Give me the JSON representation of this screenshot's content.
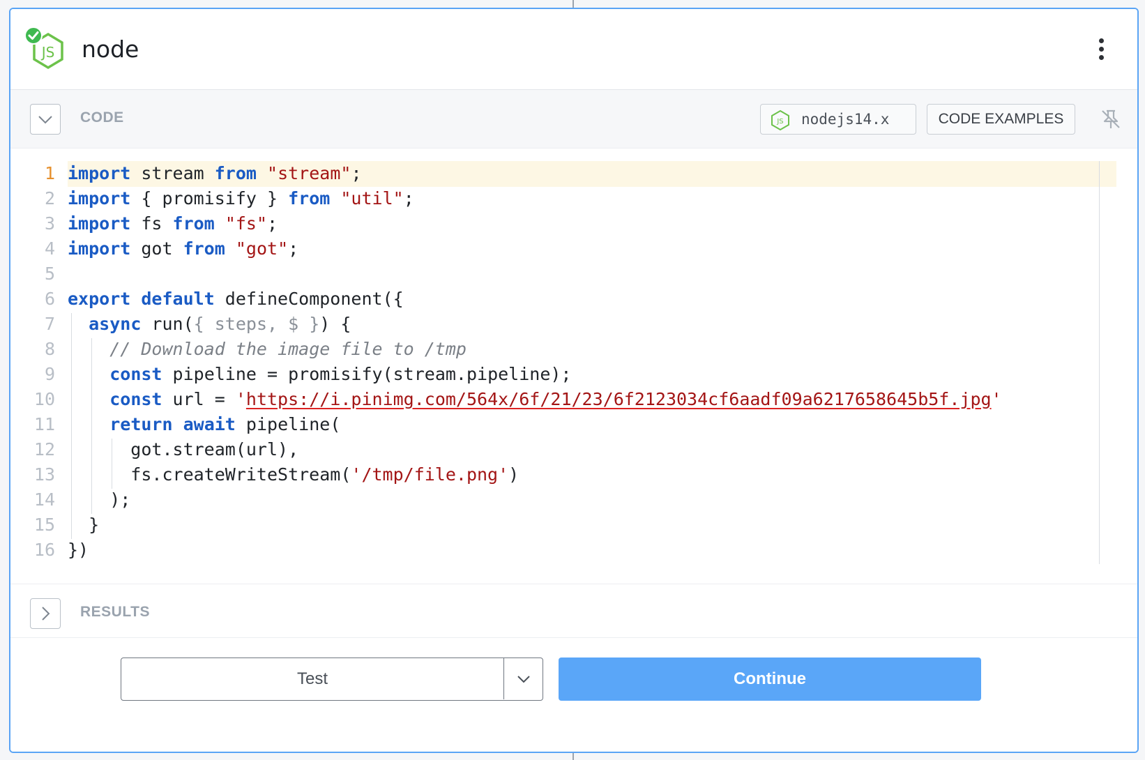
{
  "header": {
    "title": "node",
    "menu_icon": "kebab-menu-icon"
  },
  "code_section": {
    "label": "CODE",
    "runtime": "nodejs14.x",
    "examples_label": "CODE EXAMPLES"
  },
  "editor": {
    "active_line": 1,
    "lines": [
      {
        "n": "1",
        "segs": [
          {
            "t": "import",
            "c": "kw"
          },
          {
            "t": " stream "
          },
          {
            "t": "from",
            "c": "kw"
          },
          {
            "t": " "
          },
          {
            "t": "\"stream\"",
            "c": "str"
          },
          {
            "t": ";"
          }
        ]
      },
      {
        "n": "2",
        "segs": [
          {
            "t": "import",
            "c": "kw"
          },
          {
            "t": " { promisify } "
          },
          {
            "t": "from",
            "c": "kw"
          },
          {
            "t": " "
          },
          {
            "t": "\"util\"",
            "c": "str"
          },
          {
            "t": ";"
          }
        ]
      },
      {
        "n": "3",
        "segs": [
          {
            "t": "import",
            "c": "kw"
          },
          {
            "t": " fs "
          },
          {
            "t": "from",
            "c": "kw"
          },
          {
            "t": " "
          },
          {
            "t": "\"fs\"",
            "c": "str"
          },
          {
            "t": ";"
          }
        ]
      },
      {
        "n": "4",
        "segs": [
          {
            "t": "import",
            "c": "kw"
          },
          {
            "t": " got "
          },
          {
            "t": "from",
            "c": "kw"
          },
          {
            "t": " "
          },
          {
            "t": "\"got\"",
            "c": "str"
          },
          {
            "t": ";"
          }
        ]
      },
      {
        "n": "5",
        "segs": []
      },
      {
        "n": "6",
        "segs": [
          {
            "t": "export",
            "c": "kw"
          },
          {
            "t": " "
          },
          {
            "t": "default",
            "c": "kw"
          },
          {
            "t": " defineComponent({"
          }
        ]
      },
      {
        "n": "7",
        "segs": [
          {
            "t": "  "
          },
          {
            "t": "async",
            "c": "kw"
          },
          {
            "t": " run("
          },
          {
            "t": "{ steps, $ }",
            "c": "dim"
          },
          {
            "t": ") {"
          }
        ]
      },
      {
        "n": "8",
        "segs": [
          {
            "t": "    "
          },
          {
            "t": "// Download the image file to /tmp",
            "c": "cmt"
          }
        ]
      },
      {
        "n": "9",
        "segs": [
          {
            "t": "    "
          },
          {
            "t": "const",
            "c": "kw"
          },
          {
            "t": " pipeline = promisify(stream.pipeline);"
          }
        ]
      },
      {
        "n": "10",
        "segs": [
          {
            "t": "    "
          },
          {
            "t": "const",
            "c": "kw"
          },
          {
            "t": " url = "
          },
          {
            "t": "'",
            "c": "str"
          },
          {
            "t": "https://i.pinimg.com/564x/6f/21/23/6f2123034cf6aadf09a6217658645b5f.jpg",
            "c": "str url"
          },
          {
            "t": "'",
            "c": "str"
          }
        ]
      },
      {
        "n": "11",
        "segs": [
          {
            "t": "    "
          },
          {
            "t": "return",
            "c": "kw"
          },
          {
            "t": " "
          },
          {
            "t": "await",
            "c": "kw"
          },
          {
            "t": " pipeline("
          }
        ]
      },
      {
        "n": "12",
        "segs": [
          {
            "t": "      got.stream(url),"
          }
        ]
      },
      {
        "n": "13",
        "segs": [
          {
            "t": "      fs.createWriteStream("
          },
          {
            "t": "'/tmp/file.png'",
            "c": "str"
          },
          {
            "t": ")"
          }
        ]
      },
      {
        "n": "14",
        "segs": [
          {
            "t": "    );"
          }
        ]
      },
      {
        "n": "15",
        "segs": [
          {
            "t": "  }"
          }
        ]
      },
      {
        "n": "16",
        "segs": [
          {
            "t": "})"
          }
        ]
      }
    ]
  },
  "results_section": {
    "label": "RESULTS"
  },
  "footer": {
    "test_label": "Test",
    "continue_label": "Continue"
  },
  "colors": {
    "accent": "#5aa6f8",
    "border_active": "#5aa4f5",
    "keyword": "#1a5bc4",
    "string": "#a31515",
    "node_green": "#6cc24a",
    "success": "#3fb950"
  }
}
